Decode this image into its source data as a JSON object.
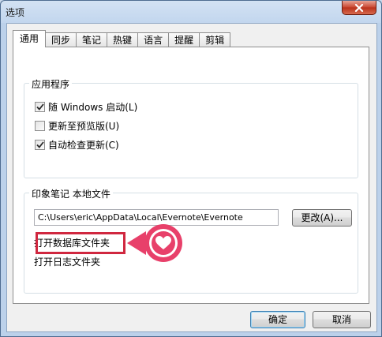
{
  "window": {
    "title": "选项"
  },
  "tabs": [
    "通用",
    "同步",
    "笔记",
    "热键",
    "语言",
    "提醒",
    "剪辑"
  ],
  "app_group": {
    "label": "应用程序",
    "checkboxes": [
      {
        "label": "随 Windows 启动(L)",
        "checked": true
      },
      {
        "label": "更新至预览版(U)",
        "checked": false
      },
      {
        "label": "自动检查更新(C)",
        "checked": true
      }
    ]
  },
  "local_group": {
    "label": "印象笔记 本地文件",
    "path_value": "C:\\Users\\eric\\AppData\\Local\\Evernote\\Evernote",
    "change_button": "更改(A)...",
    "open_db_folder": "打开数据库文件夹",
    "open_log_folder": "打开日志文件夹"
  },
  "footer": {
    "ok_button": "确定",
    "cancel_button": "取消"
  },
  "colors": {
    "highlight": "#d0273f",
    "marker": "#e8406a"
  },
  "icons": {
    "marker": "heart-icon",
    "close": "close-icon",
    "check": "checkmark-icon"
  }
}
